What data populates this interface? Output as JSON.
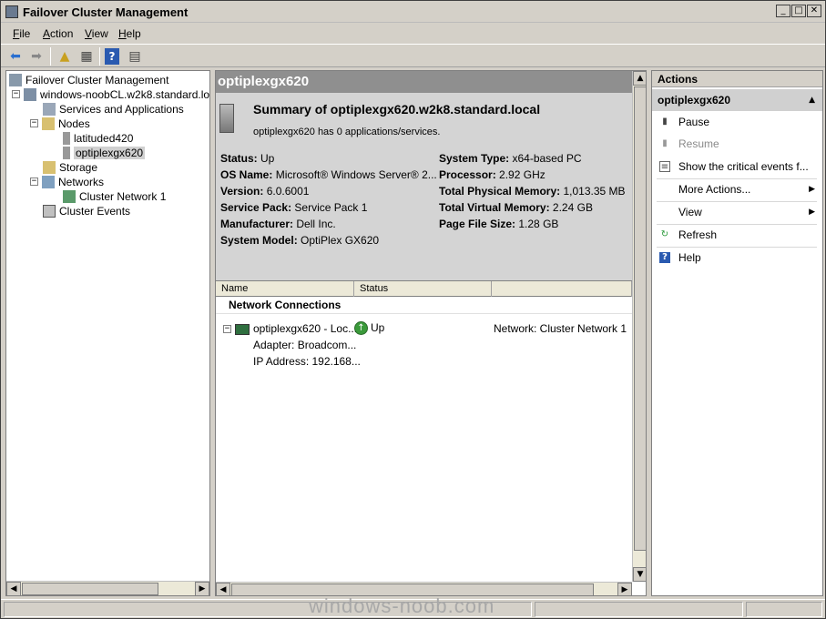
{
  "window": {
    "title": "Failover Cluster Management"
  },
  "menu": [
    {
      "label_ul": "F",
      "label_rest": "ile"
    },
    {
      "label_ul": "A",
      "label_rest": "ction"
    },
    {
      "label_ul": "V",
      "label_rest": "iew"
    },
    {
      "label_ul": "H",
      "label_rest": "elp"
    }
  ],
  "tree": {
    "root": "Failover Cluster Management",
    "cluster": "windows-noobCL.w2k8.standard.local",
    "services": "Services and Applications",
    "nodes": "Nodes",
    "node1": "latituded420",
    "node2": "optiplexgx620",
    "storage": "Storage",
    "networks": "Networks",
    "network1": "Cluster Network 1",
    "events": "Cluster Events"
  },
  "center": {
    "header": "optiplexgx620",
    "summary_title": "Summary of optiplexgx620.w2k8.standard.local",
    "summary_sub": "optiplexgx620 has 0 applications/services.",
    "left_props": [
      {
        "k": "Status:",
        "v": "Up"
      },
      {
        "k": "OS Name:",
        "v": "Microsoft® Windows Server® 2..."
      },
      {
        "k": "Version:",
        "v": "6.0.6001"
      },
      {
        "k": "Service Pack:",
        "v": "Service Pack 1"
      },
      {
        "k": "Manufacturer:",
        "v": "Dell Inc."
      },
      {
        "k": "System Model:",
        "v": "OptiPlex GX620"
      }
    ],
    "right_props": [
      {
        "k": "System Type:",
        "v": "x64-based PC"
      },
      {
        "k": "Processor:",
        "v": "2.92 GHz"
      },
      {
        "k": "Total Physical Memory:",
        "v": "1,013.35 MB"
      },
      {
        "k": "Total Virtual Memory:",
        "v": "2.24 GB"
      },
      {
        "k": "Page File Size:",
        "v": "1.28 GB"
      }
    ],
    "columns": [
      "Name",
      "Status"
    ],
    "group": "Network Connections",
    "connection": {
      "name": "optiplexgx620 - Loc...",
      "status": "Up",
      "network": "Network: Cluster Network 1",
      "adapter": "Adapter:  Broadcom...",
      "ip": "IP Address:  192.168..."
    }
  },
  "actions": {
    "header": "Actions",
    "sub": "optiplexgx620",
    "items": [
      "Pause",
      "Resume",
      "Show the critical events f...",
      "More Actions...",
      "View",
      "Refresh",
      "Help"
    ]
  },
  "watermark": "windows-noob.com"
}
